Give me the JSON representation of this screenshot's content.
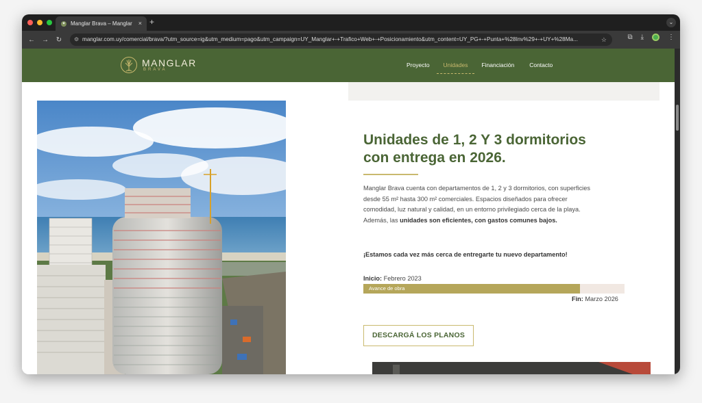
{
  "browser": {
    "tab_title": "Manglar Brava – Manglar",
    "tab_close": "×",
    "new_tab": "+",
    "url": "manglar.com.uy/comercial/brava/?utm_source=ig&utm_medium=pago&utm_campaign=UY_Manglar+-+Trafico+Web+-+Posicionamiento&utm_content=UY_PG+-+Punta+%28Inv%29+-+UY+%28Ma...",
    "traffic_lights": [
      "#ff5f57",
      "#febc2e",
      "#28c840"
    ]
  },
  "site": {
    "logo_text": "MANGLAR",
    "logo_sub": "BRAVA",
    "nav": [
      {
        "label": "Proyecto"
      },
      {
        "label": "Unidades"
      },
      {
        "label": "Financiación"
      },
      {
        "label": "Contacto"
      }
    ],
    "header_color": "#4a6535",
    "accent_color": "#c9b96e"
  },
  "content": {
    "title_line1": "Unidades de 1, 2 Y 3 dormitorios",
    "title_line2": "con entrega en 2026.",
    "desc_plain": "Manglar Brava cuenta con departamentos de 1, 2 y 3 dormitorios, con superficies desde 55 m² hasta 300 m² comerciales. Espacios diseñados para ofrecer comodidad, luz natural y calidad, en un entorno privilegiado cerca de la playa. Además, las ",
    "desc_bold": "unidades son eficientes, con gastos comunes bajos.",
    "highlight": "¡Estamos cada vez más cerca de entregarte tu nuevo departamento!",
    "start_label": "Inicio:",
    "start_value": " Febrero 2023",
    "progress_label": "Avance de obra",
    "progress_fraction": 0.83,
    "end_label": "Fin:",
    "end_value": " Marzo 2026",
    "download_button": "DESCARGÁ LOS PLANOS"
  },
  "icons": {
    "logo": "tree-icon",
    "whatsapp": "whatsapp-icon"
  }
}
